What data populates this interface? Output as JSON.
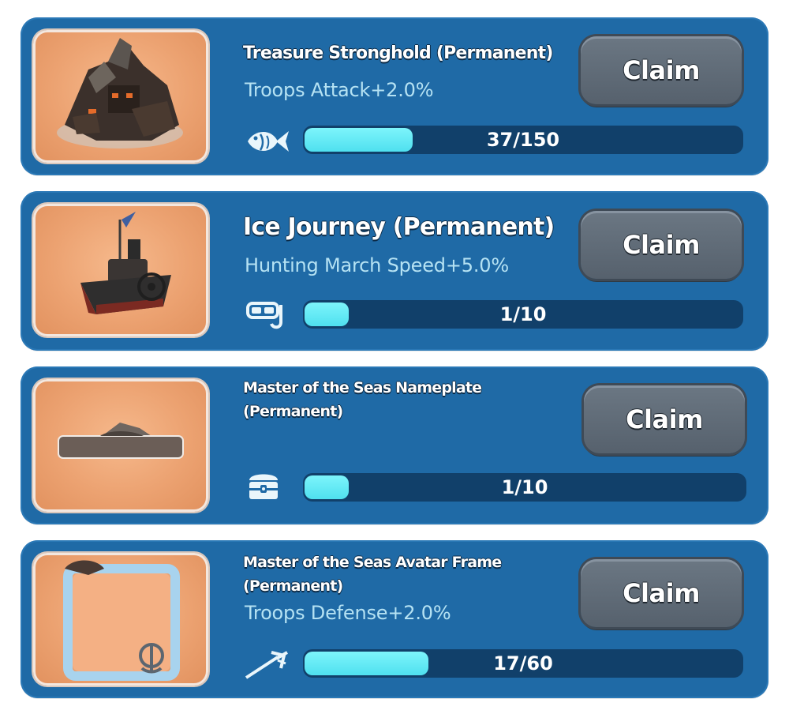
{
  "tasks": [
    {
      "title": "Treasure Stronghold (Permanent)",
      "bonus": "Troops Attack+2.0%",
      "claim_label": "Claim",
      "resource_icon": "fish-icon",
      "progress_text": "37/150",
      "progress_fraction": 0.247
    },
    {
      "title": "Ice Journey (Permanent)",
      "bonus": "Hunting March Speed+5.0%",
      "claim_label": "Claim",
      "resource_icon": "diving-mask-icon",
      "progress_text": "1/10",
      "progress_fraction": 0.1
    },
    {
      "title_line1": "Master of the Seas Nameplate",
      "title_line2": "(Permanent)",
      "claim_label": "Claim",
      "resource_icon": "treasure-chest-icon",
      "progress_text": "1/10",
      "progress_fraction": 0.1
    },
    {
      "title_line1": "Master of the Seas Avatar Frame",
      "title_line2": "(Permanent)",
      "bonus": "Troops Defense+2.0%",
      "claim_label": "Claim",
      "resource_icon": "trident-icon",
      "progress_text": "17/60",
      "progress_fraction": 0.283
    }
  ],
  "colors": {
    "card_bg": "#1f6aa6",
    "progress_fill": "#5fe8f4",
    "progress_track": "#11406a",
    "claim_button": "#5f6a76",
    "bonus_text": "#b5e2f3"
  }
}
